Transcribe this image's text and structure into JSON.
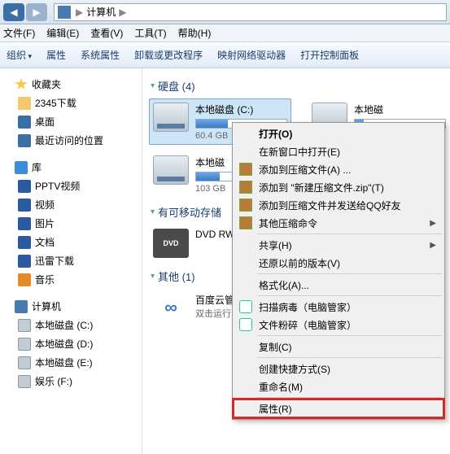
{
  "titlebar": {
    "breadcrumb": [
      "计算机"
    ],
    "sep": "▶"
  },
  "menubar": [
    "文件(F)",
    "编辑(E)",
    "查看(V)",
    "工具(T)",
    "帮助(H)"
  ],
  "toolbar": [
    "组织",
    "属性",
    "系统属性",
    "卸载或更改程序",
    "映射网络驱动器",
    "打开控制面板"
  ],
  "sidebar": {
    "fav": {
      "label": "收藏夹",
      "items": [
        "2345下载",
        "桌面",
        "最近访问的位置"
      ]
    },
    "lib": {
      "label": "库",
      "items": [
        "PPTV视频",
        "视频",
        "图片",
        "文档",
        "迅雷下载",
        "音乐"
      ]
    },
    "pc": {
      "label": "计算机",
      "items": [
        "本地磁盘 (C:)",
        "本地磁盘 (D:)",
        "本地磁盘 (E:)",
        "娱乐 (F:)"
      ]
    }
  },
  "content": {
    "sec_hdd": "硬盘 (4)",
    "sec_remov": "有可移动存储",
    "sec_other": "其他 (1)",
    "drives": [
      {
        "name": "本地磁盘 (C:)",
        "sub": "60.4 GB",
        "fill": 35,
        "selected": true
      },
      {
        "name": "本地磁",
        "sub": "",
        "fill": 0,
        "selected": false
      },
      {
        "name": "本地磁",
        "sub": "103 GB",
        "fill": 20,
        "selected": false
      }
    ],
    "dvd": {
      "name": "DVD RW"
    },
    "other": {
      "name": "百度云管",
      "sub": "双击运行"
    }
  },
  "context_menu": [
    {
      "label": "打开(O)",
      "bold": true
    },
    {
      "label": "在新窗口中打开(E)"
    },
    {
      "label": "添加到压缩文件(A) ...",
      "icon": "zip"
    },
    {
      "label": "添加到 \"新建压缩文件.zip\"(T)",
      "icon": "zip"
    },
    {
      "label": "添加到压缩文件并发送给QQ好友",
      "icon": "zip"
    },
    {
      "label": "其他压缩命令",
      "icon": "zip",
      "sub": true
    },
    {
      "sep": true
    },
    {
      "label": "共享(H)",
      "sub": true
    },
    {
      "label": "还原以前的版本(V)"
    },
    {
      "sep": true
    },
    {
      "label": "格式化(A)..."
    },
    {
      "sep": true
    },
    {
      "label": "扫描病毒（电脑管家）",
      "icon": "qq"
    },
    {
      "label": "文件粉碎（电脑管家）",
      "icon": "qq"
    },
    {
      "sep": true
    },
    {
      "label": "复制(C)"
    },
    {
      "sep": true
    },
    {
      "label": "创建快捷方式(S)"
    },
    {
      "label": "重命名(M)"
    },
    {
      "sep": true
    },
    {
      "label": "属性(R)",
      "highlight": true
    }
  ]
}
